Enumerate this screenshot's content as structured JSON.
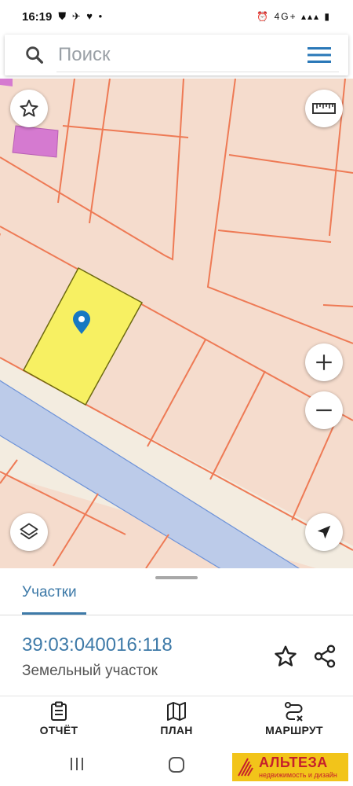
{
  "status_bar": {
    "time": "16:19",
    "left_icons": "⛊ ✈ ♥ •",
    "right_icons": "⏰ 4G+ ▴▴▴ ▮"
  },
  "search": {
    "placeholder": "Поиск",
    "icon": "search-icon",
    "menu_icon": "hamburger-menu-icon"
  },
  "map": {
    "controls": {
      "favorites_icon": "star-icon",
      "ruler_icon": "ruler-icon",
      "zoom_in": "+",
      "zoom_out": "−",
      "layers_icon": "layers-icon",
      "locate_icon": "navigation-arrow-icon"
    },
    "colors": {
      "background": "#f5dccd",
      "boundary": "#ee7a55",
      "selected_parcel": "#f7f062",
      "road": "#f3ece0",
      "water": "#bccbe9",
      "building": "#d57ad0",
      "pin": "#1778c2"
    }
  },
  "sheet": {
    "tab_label": "Участки",
    "parcel_number": "39:03:040016:118",
    "parcel_type": "Земельный участок",
    "favorite_icon": "star-outline-icon",
    "share_icon": "share-icon"
  },
  "actions": [
    {
      "label": "ОТЧЁТ",
      "icon": "clipboard-icon"
    },
    {
      "label": "ПЛАН",
      "icon": "map-icon"
    },
    {
      "label": "МАРШРУТ",
      "icon": "route-icon"
    }
  ],
  "navbar": {
    "recent_icon": "recent-apps-icon",
    "home_icon": "home-icon"
  },
  "logo": {
    "name": "АЛЬТЕЗА",
    "tagline": "недвижимость и дизайн"
  }
}
